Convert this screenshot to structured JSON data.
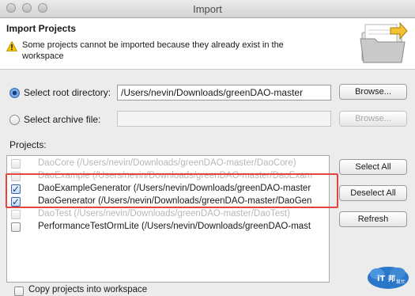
{
  "window": {
    "title": "Import"
  },
  "banner": {
    "title": "Import Projects",
    "message": "Some projects cannot be imported because they already exist in the workspace",
    "warn_icon": "warning-icon",
    "folder_icon": "import-folder-icon"
  },
  "root_dir": {
    "label": "Select root directory:",
    "value": "/Users/nevin/Downloads/greenDAO-master",
    "browse": "Browse...",
    "selected": true
  },
  "archive": {
    "label": "Select archive file:",
    "value": "",
    "browse": "Browse...",
    "selected": false
  },
  "projects": {
    "label": "Projects:",
    "items": [
      {
        "text": "DaoCore (/Users/nevin/Downloads/greenDAO-master/DaoCore)",
        "checked": false,
        "enabled": false
      },
      {
        "text": "DaoExample (/Users/nevin/Downloads/greenDAO-master/DaoExam",
        "checked": false,
        "enabled": false
      },
      {
        "text": "DaoExampleGenerator (/Users/nevin/Downloads/greenDAO-master",
        "checked": true,
        "enabled": true
      },
      {
        "text": "DaoGenerator (/Users/nevin/Downloads/greenDAO-master/DaoGen",
        "checked": true,
        "enabled": true
      },
      {
        "text": "DaoTest (/Users/nevin/Downloads/greenDAO-master/DaoTest)",
        "checked": false,
        "enabled": false
      },
      {
        "text": "PerformanceTestOrmLite (/Users/nevin/Downloads/greenDAO-mast",
        "checked": false,
        "enabled": true
      }
    ]
  },
  "buttons": {
    "select_all": "Select All",
    "deselect_all": "Deselect All",
    "refresh": "Refresh"
  },
  "copy_option": {
    "label": "Copy projects into workspace",
    "checked": false
  },
  "colors": {
    "highlight": "#e0453e",
    "accent": "#3b6fb6"
  }
}
